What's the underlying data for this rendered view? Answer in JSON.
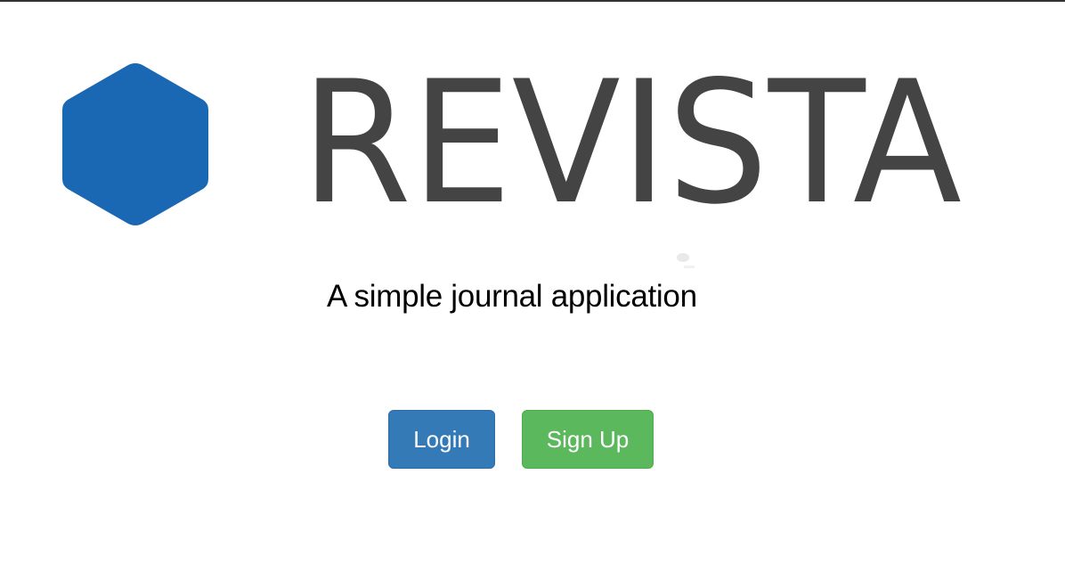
{
  "logo": {
    "wordmark": "REVISTA",
    "icon": "hexagon-logo-icon"
  },
  "tagline": "A simple journal application",
  "actions": {
    "login_label": "Login",
    "signup_label": "Sign Up"
  },
  "colors": {
    "brand_blue": "#1a68b3",
    "wordmark_gray": "#444444",
    "login_bg": "#337ab7",
    "login_border": "#2e6da4",
    "signup_bg": "#5cb85c",
    "signup_border": "#4cae4c"
  }
}
